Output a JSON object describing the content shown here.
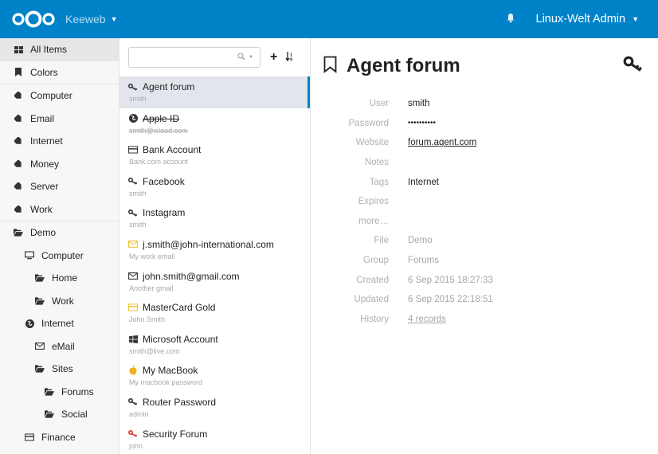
{
  "topbar": {
    "app_name": "Keeweb",
    "user_name": "Linux-Welt Admin",
    "bg_color": "#0082c9"
  },
  "sidebar": {
    "items": [
      {
        "label": "All Items",
        "icon": "grid-icon"
      },
      {
        "label": "Colors",
        "icon": "bookmark-icon"
      },
      {
        "label": "Computer",
        "icon": "tag-icon"
      },
      {
        "label": "Email",
        "icon": "tag-icon"
      },
      {
        "label": "Internet",
        "icon": "tag-icon"
      },
      {
        "label": "Money",
        "icon": "tag-icon"
      },
      {
        "label": "Server",
        "icon": "tag-icon"
      },
      {
        "label": "Work",
        "icon": "tag-icon"
      },
      {
        "label": "Demo",
        "icon": "folder-open-icon"
      },
      {
        "label": "Computer",
        "icon": "monitor-icon"
      },
      {
        "label": "Home",
        "icon": "folder-open-icon"
      },
      {
        "label": "Work",
        "icon": "folder-open-icon"
      },
      {
        "label": "Internet",
        "icon": "globe-icon"
      },
      {
        "label": "eMail",
        "icon": "envelope-icon"
      },
      {
        "label": "Sites",
        "icon": "folder-open-icon"
      },
      {
        "label": "Forums",
        "icon": "folder-open-icon"
      },
      {
        "label": "Social",
        "icon": "folder-open-icon"
      },
      {
        "label": "Finance",
        "icon": "credit-card-icon"
      }
    ]
  },
  "list": {
    "search_placeholder": "",
    "add_label": "+",
    "sort_label": "↓⇅",
    "entries": [
      {
        "title": "Agent forum",
        "subtitle": "smith",
        "icon": "key-icon"
      },
      {
        "title": "Apple ID",
        "subtitle": "smith@icloud.com",
        "icon": "globe-icon"
      },
      {
        "title": "Bank Account",
        "subtitle": "Bank.com account",
        "icon": "credit-card-icon"
      },
      {
        "title": "Facebook",
        "subtitle": "smith",
        "icon": "key-icon"
      },
      {
        "title": "Instagram",
        "subtitle": "smith",
        "icon": "key-icon"
      },
      {
        "title": "j.smith@john-international.com",
        "subtitle": "My work email",
        "icon": "envelope-icon"
      },
      {
        "title": "john.smith@gmail.com",
        "subtitle": "Another gmail",
        "icon": "envelope-icon"
      },
      {
        "title": "MasterCard Gold",
        "subtitle": "John Smith",
        "icon": "credit-card-icon"
      },
      {
        "title": "Microsoft Account",
        "subtitle": "smith@live.com",
        "icon": "windows-icon"
      },
      {
        "title": "My MacBook",
        "subtitle": "My macbook password",
        "icon": "apple-icon"
      },
      {
        "title": "Router Password",
        "subtitle": "admin",
        "icon": "key-icon"
      },
      {
        "title": "Security Forum",
        "subtitle": "john",
        "icon": "key-icon"
      }
    ]
  },
  "detail": {
    "title": "Agent forum",
    "fields": [
      {
        "label": "User",
        "value": "smith"
      },
      {
        "label": "Password",
        "value": "••••••••••"
      },
      {
        "label": "Website",
        "value": "forum.agent.com"
      },
      {
        "label": "Notes",
        "value": ""
      },
      {
        "label": "Tags",
        "value": "Internet"
      },
      {
        "label": "Expires",
        "value": ""
      },
      {
        "label": "more…",
        "value": ""
      },
      {
        "label": "File",
        "value": "Demo"
      },
      {
        "label": "Group",
        "value": "Forums"
      },
      {
        "label": "Created",
        "value": "6 Sep 2015 18:27:33"
      },
      {
        "label": "Updated",
        "value": "6 Sep 2015 22:18:51"
      },
      {
        "label": "History",
        "value": "4 records"
      }
    ]
  }
}
